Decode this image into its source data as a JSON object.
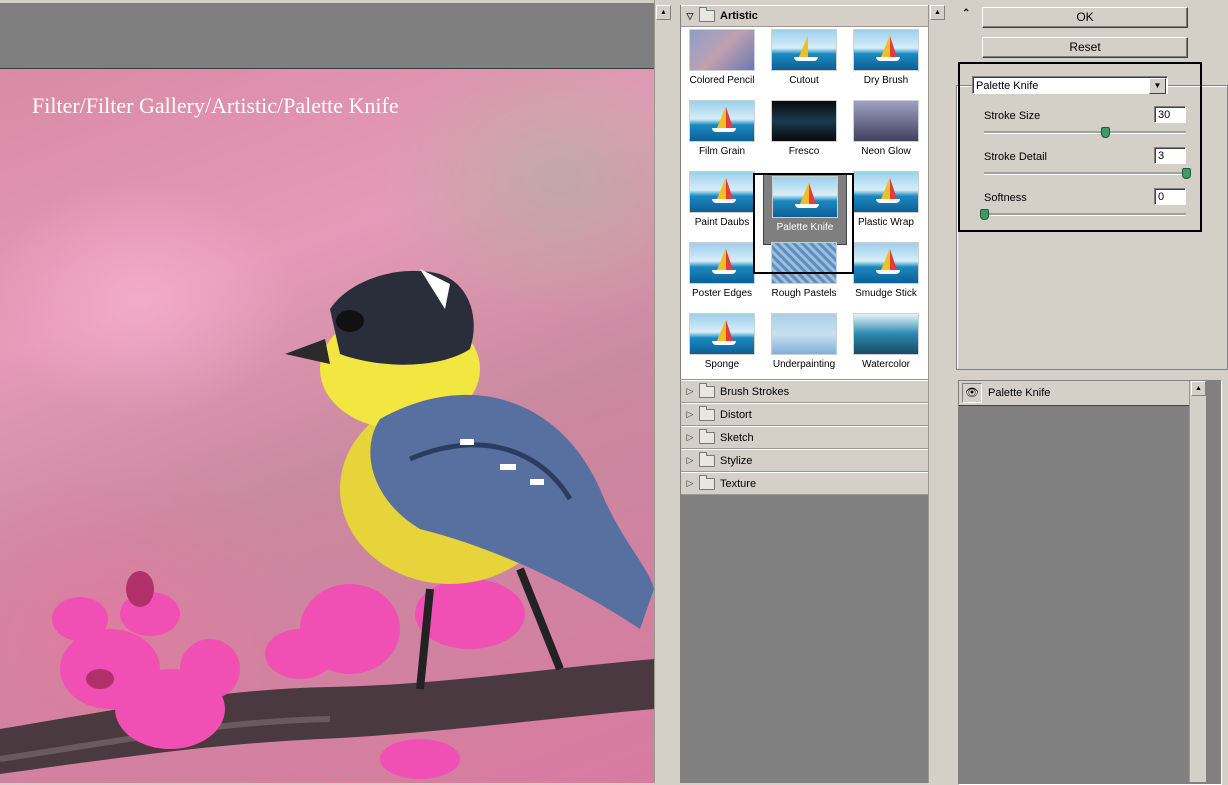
{
  "preview": {
    "caption": "Filter/Filter Gallery/Artistic/Palette Knife"
  },
  "browser": {
    "open_category": "Artistic",
    "thumbnails": [
      {
        "label": "Colored Pencil"
      },
      {
        "label": "Cutout"
      },
      {
        "label": "Dry Brush"
      },
      {
        "label": "Film Grain"
      },
      {
        "label": "Fresco"
      },
      {
        "label": "Neon Glow"
      },
      {
        "label": "Paint Daubs"
      },
      {
        "label": "Palette Knife"
      },
      {
        "label": "Plastic Wrap"
      },
      {
        "label": "Poster Edges"
      },
      {
        "label": "Rough Pastels"
      },
      {
        "label": "Smudge Stick"
      },
      {
        "label": "Sponge"
      },
      {
        "label": "Underpainting"
      },
      {
        "label": "Watercolor"
      }
    ],
    "selected": "Palette Knife",
    "categories": [
      "Brush Strokes",
      "Distort",
      "Sketch",
      "Stylize",
      "Texture"
    ]
  },
  "controls": {
    "ok_label": "OK",
    "reset_label": "Reset",
    "filter_select": "Palette Knife",
    "params": [
      {
        "label": "Stroke Size",
        "value": "30",
        "max": 50
      },
      {
        "label": "Stroke Detail",
        "value": "3",
        "max": 3
      },
      {
        "label": "Softness",
        "value": "0",
        "max": 10
      }
    ]
  },
  "layers": {
    "items": [
      {
        "label": "Palette Knife"
      }
    ]
  },
  "icons": {
    "collapse": "double-chevron-up-icon",
    "eye": "eye-icon",
    "folder": "folder-icon"
  },
  "colors": {
    "panel": "#d4d0c8",
    "preview_bg": "#7f7f7f",
    "slider_knob": "#3f9a6a"
  }
}
